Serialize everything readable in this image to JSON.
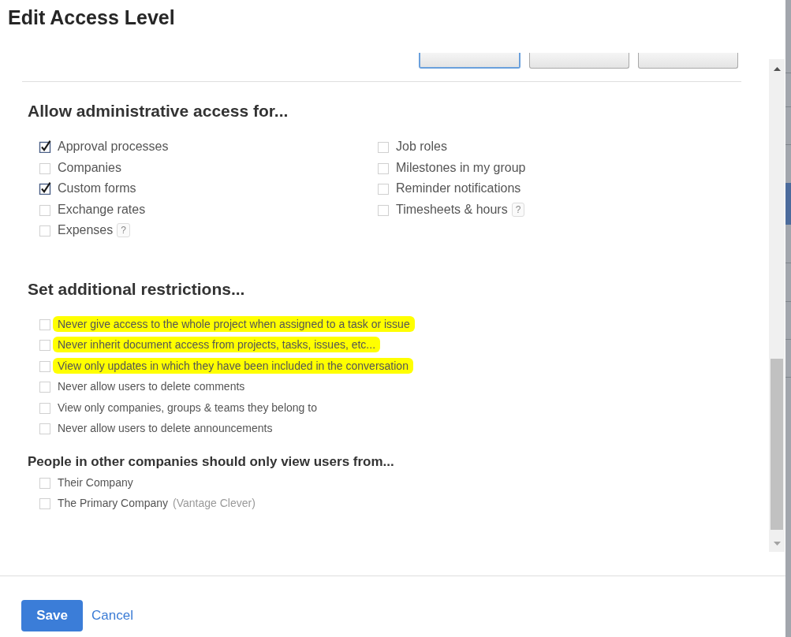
{
  "window": {
    "title": "Edit Access Level"
  },
  "permission_row": {
    "buttons": [
      {
        "selected": true
      },
      {
        "selected": false
      },
      {
        "selected": false
      }
    ]
  },
  "admin_access": {
    "heading": "Allow administrative access for...",
    "columns": [
      [
        {
          "label": "Approval processes",
          "checked": true
        },
        {
          "label": "Companies",
          "checked": false
        },
        {
          "label": "Custom forms",
          "checked": true
        },
        {
          "label": "Exchange rates",
          "checked": false
        },
        {
          "label": "Expenses",
          "checked": false,
          "help": "?"
        }
      ],
      [
        {
          "label": "Job roles",
          "checked": false
        },
        {
          "label": "Milestones in my group",
          "checked": false
        },
        {
          "label": "Reminder notifications",
          "checked": false
        },
        {
          "label": "Timesheets & hours",
          "checked": false,
          "help": "?"
        }
      ]
    ]
  },
  "restrictions": {
    "heading": "Set additional restrictions...",
    "items": [
      {
        "label": "Never give access to the whole project when assigned to a task or issue",
        "checked": false,
        "highlighted": true
      },
      {
        "label": "Never inherit document access from projects, tasks, issues, etc...",
        "checked": false,
        "highlighted": true
      },
      {
        "label": "View only updates in which they have been included in the conversation",
        "checked": false,
        "highlighted": true
      },
      {
        "label": "Never allow users to delete comments",
        "checked": false,
        "highlighted": false
      },
      {
        "label": "View only companies, groups & teams they belong to",
        "checked": false,
        "highlighted": false
      },
      {
        "label": "Never allow users to delete announcements",
        "checked": false,
        "highlighted": false
      }
    ]
  },
  "visibility": {
    "heading": "People in other companies should only view users from...",
    "items": [
      {
        "label": "Their Company",
        "checked": false
      },
      {
        "label": "The Primary Company",
        "note": "(Vantage Clever)",
        "checked": false
      }
    ]
  },
  "footer": {
    "buttons": [
      {
        "label": "Save",
        "kind": "primary"
      },
      {
        "label": "Cancel",
        "kind": "link"
      }
    ]
  }
}
